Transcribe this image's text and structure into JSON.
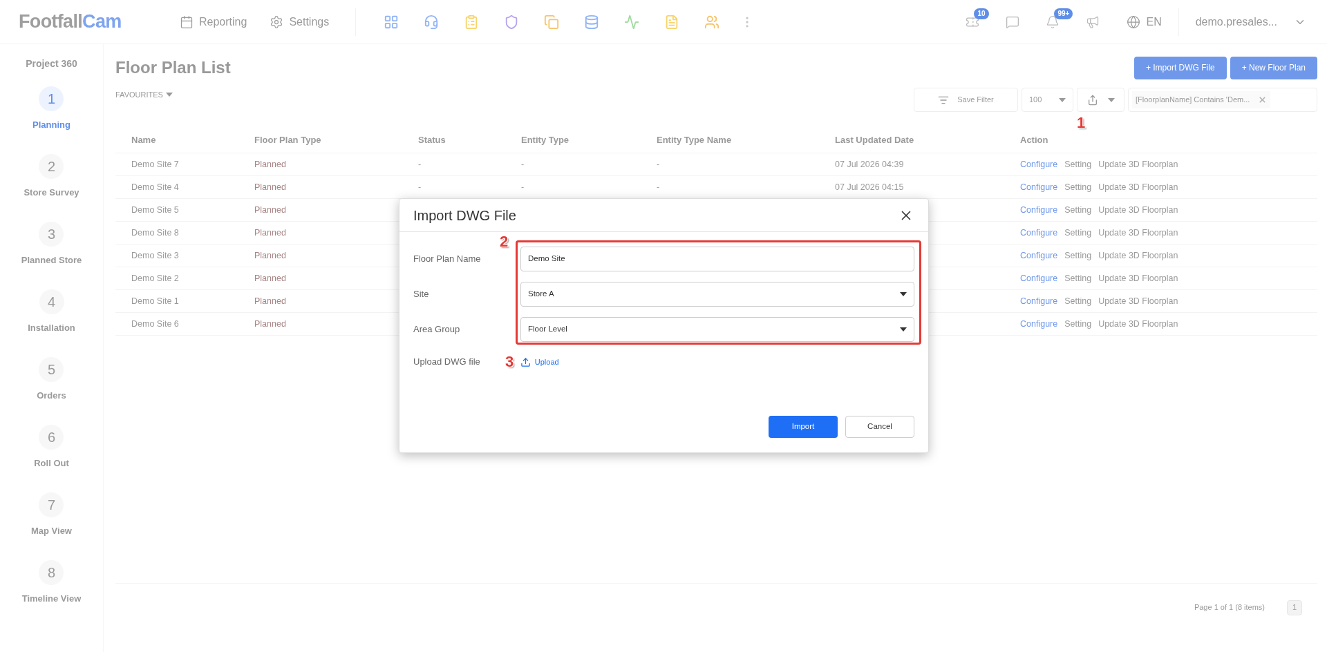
{
  "topbar": {
    "logo": {
      "part1": "Footfall",
      "part2": "Cam"
    },
    "nav": [
      {
        "kind": "calendar",
        "label": "Reporting"
      },
      {
        "kind": "gear",
        "label": "Settings"
      }
    ],
    "apps": [
      {
        "kind": "grid",
        "color": "#93b4f7"
      },
      {
        "kind": "headset",
        "color": "#93b4f7"
      },
      {
        "kind": "clipboard",
        "color": "#f7d46b"
      },
      {
        "kind": "shield",
        "color": "#b9a2f0"
      },
      {
        "kind": "copy",
        "color": "#f7c46b"
      },
      {
        "kind": "database",
        "color": "#93b4f7"
      },
      {
        "kind": "activity",
        "color": "#9fdc9f"
      },
      {
        "kind": "file",
        "color": "#f7d46b"
      },
      {
        "kind": "people",
        "color": "#f7c46b"
      }
    ],
    "notifications": [
      {
        "kind": "ticket",
        "badge": "10"
      },
      {
        "kind": "chat"
      },
      {
        "kind": "bell",
        "badge": "99+"
      },
      {
        "kind": "megaphone"
      }
    ],
    "language": "EN",
    "user": "demo.presales..."
  },
  "sidebar": {
    "title": "Project 360",
    "steps": [
      {
        "number": "1",
        "label": "Planning",
        "selected": true
      },
      {
        "number": "2",
        "label": "Store Survey",
        "selected": false
      },
      {
        "number": "3",
        "label": "Planned Store",
        "selected": false
      },
      {
        "number": "4",
        "label": "Installation",
        "selected": false
      },
      {
        "number": "5",
        "label": "Orders",
        "selected": false
      },
      {
        "number": "6",
        "label": "Roll Out",
        "selected": false
      },
      {
        "number": "7",
        "label": "Map View",
        "selected": false
      },
      {
        "number": "8",
        "label": "Timeline View",
        "selected": false
      }
    ]
  },
  "page": {
    "title": "Floor Plan List",
    "buttons": [
      "+ Import DWG File",
      "+ New Floor Plan"
    ],
    "favourites": "FAVOURITES",
    "toolbar": {
      "save_filter": "Save Filter",
      "page_size": "100",
      "filter_chip": "[FloorplanName] Contains 'Dem..."
    }
  },
  "table": {
    "columns": [
      "Name",
      "Floor Plan Type",
      "Status",
      "Entity Type",
      "Entity Type Name",
      "Last Updated Date",
      "Action"
    ],
    "rows": [
      {
        "cells": [
          "Demo Site 7",
          "Planned",
          "-",
          "-",
          "-",
          "07 Jul 2026 04:39"
        ],
        "actions": [
          "Configure",
          "Setting",
          "Update 3D Floorplan"
        ]
      },
      {
        "cells": [
          "Demo Site 4",
          "Planned",
          "-",
          "-",
          "-",
          "07 Jul 2026 04:15"
        ],
        "actions": [
          "Configure",
          "Setting",
          "Update 3D Floorplan"
        ]
      },
      {
        "cells": [
          "Demo Site 5",
          "Planned"
        ],
        "actions": [
          "Configure",
          "Setting",
          "Update 3D Floorplan"
        ]
      },
      {
        "cells": [
          "Demo Site 8",
          "Planned"
        ],
        "actions": [
          "Configure",
          "Setting",
          "Update 3D Floorplan"
        ]
      },
      {
        "cells": [
          "Demo Site 3",
          "Planned"
        ],
        "actions": [
          "Configure",
          "Setting",
          "Update 3D Floorplan"
        ]
      },
      {
        "cells": [
          "Demo Site 2",
          "Planned"
        ],
        "actions": [
          "Configure",
          "Setting",
          "Update 3D Floorplan"
        ]
      },
      {
        "cells": [
          "Demo Site 1",
          "Planned"
        ],
        "actions": [
          "Configure",
          "Setting",
          "Update 3D Floorplan"
        ]
      },
      {
        "cells": [
          "Demo Site 6",
          "Planned"
        ],
        "actions": [
          "Configure",
          "Setting",
          "Update 3D Floorplan"
        ]
      }
    ]
  },
  "pagination": {
    "summary": "Page 1 of 1 (8 items)",
    "pages": [
      {
        "label": "1",
        "selected": true
      }
    ]
  },
  "dialog": {
    "title": "Import DWG File",
    "fields": [
      {
        "kind": "text",
        "label": "Floor Plan Name",
        "value": "Demo Site"
      },
      {
        "kind": "select",
        "label": "Site",
        "value": "Store A"
      },
      {
        "kind": "select",
        "label": "Area Group",
        "value": "Floor Level"
      }
    ],
    "upload": {
      "label": "Upload DWG file",
      "link": "Upload"
    },
    "buttons": {
      "primary": "Import",
      "secondary": "Cancel"
    }
  },
  "annotations": [
    "1",
    "2",
    "3"
  ]
}
